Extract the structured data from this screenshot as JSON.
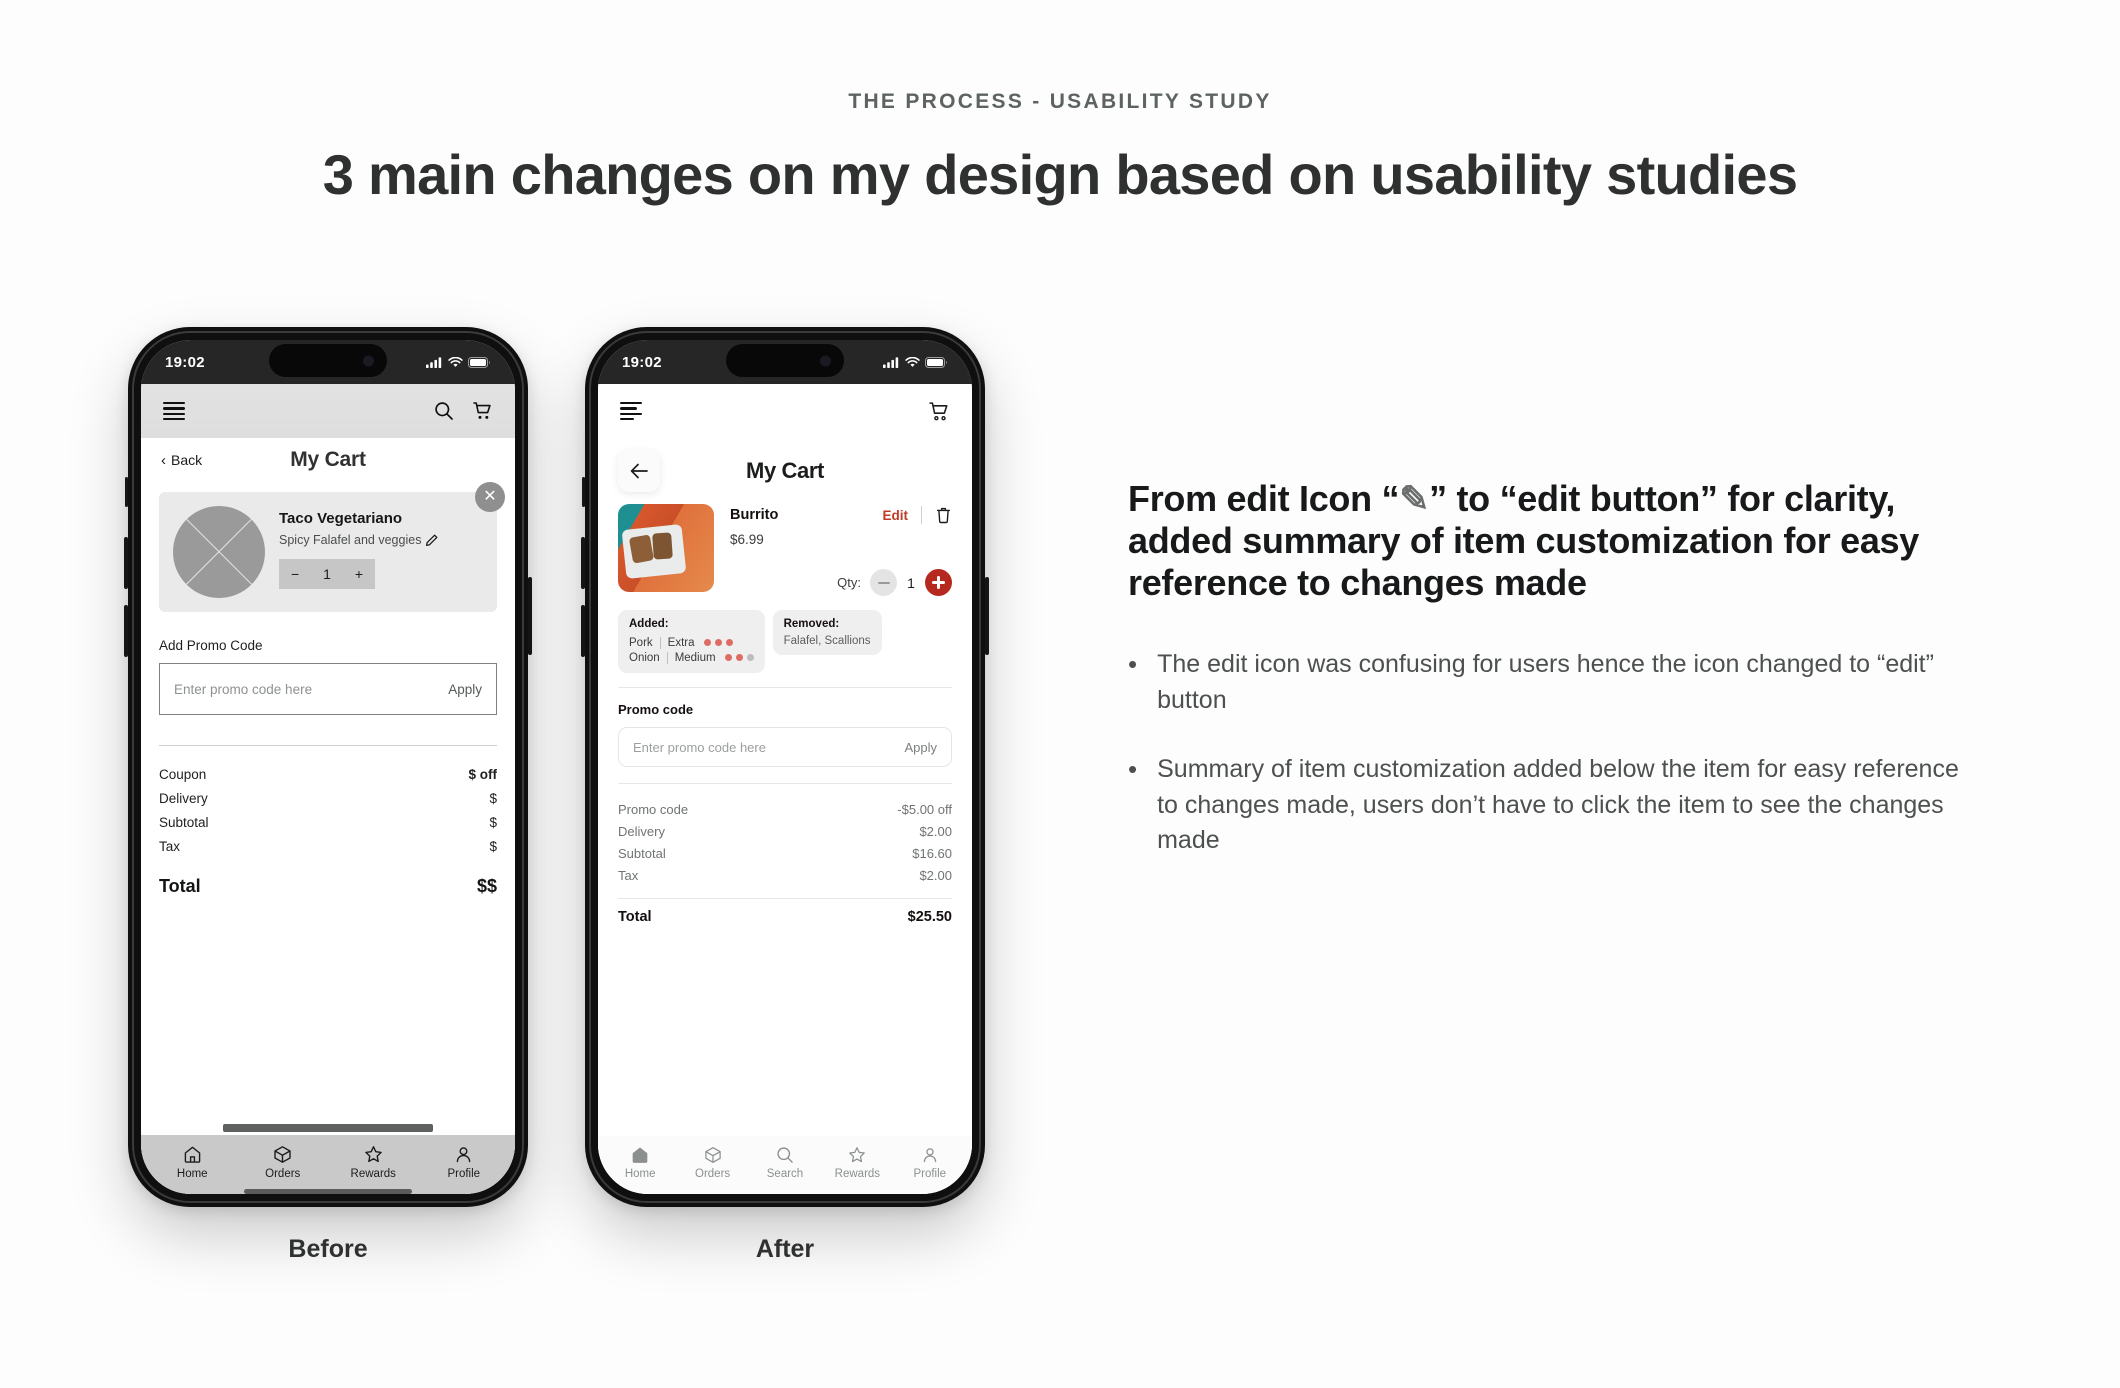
{
  "header": {
    "eyebrow": "THE PROCESS - USABILITY STUDY",
    "title": "3 main changes on my design based on usability studies"
  },
  "colors": {
    "accent_red": "#b5291f",
    "edit_red": "#bf3b25",
    "spice_dot": "#dd6d62",
    "spice_dot_empty": "#bdbdbd",
    "page_bg": "#fdfdfd",
    "text_dark": "#2e312f",
    "text_muted": "#6f7472"
  },
  "before": {
    "caption": "Before",
    "status": {
      "time": "19:02",
      "signal_icon": "cellular-bars-icon",
      "wifi_icon": "wifi-icon",
      "battery_icon": "battery-icon"
    },
    "appbar": {
      "menu_icon": "hamburger-menu-icon",
      "search_icon": "search-icon",
      "cart_icon": "cart-icon"
    },
    "back_label": "Back",
    "page_title": "My Cart",
    "item": {
      "name": "Taco Vegetariano",
      "description": "Spicy Falafel and veggies",
      "edit_icon": "pencil-edit-icon",
      "remove_icon": "close-x-icon",
      "qty_minus": "−",
      "qty_value": "1",
      "qty_plus": "+"
    },
    "promo": {
      "label": "Add Promo Code",
      "placeholder": "Enter promo code here",
      "apply_label": "Apply"
    },
    "summary_rows": [
      {
        "label": "Coupon",
        "value": "$ off"
      },
      {
        "label": "Delivery",
        "value": "$"
      },
      {
        "label": "Subtotal",
        "value": "$"
      },
      {
        "label": "Tax",
        "value": "$"
      }
    ],
    "total": {
      "label": "Total",
      "value": "$$"
    },
    "tabs": [
      {
        "label": "Home",
        "icon": "home-icon"
      },
      {
        "label": "Orders",
        "icon": "box-icon"
      },
      {
        "label": "Rewards",
        "icon": "star-icon"
      },
      {
        "label": "Profile",
        "icon": "person-icon"
      }
    ]
  },
  "after": {
    "caption": "After",
    "status": {
      "time": "19:02",
      "signal_icon": "cellular-bars-icon",
      "wifi_icon": "wifi-icon",
      "battery_icon": "battery-icon"
    },
    "appbar": {
      "menu_icon": "hamburger-menu-icon",
      "cart_icon": "cart-icon"
    },
    "back_icon": "arrow-left-icon",
    "page_title": "My Cart",
    "item": {
      "name": "Burrito",
      "price": "$6.99",
      "edit_label": "Edit",
      "delete_icon": "trash-icon",
      "qty_label": "Qty:",
      "qty_minus": "−",
      "qty_value": "1",
      "qty_plus": "+",
      "thumb_icon": "burrito-photo"
    },
    "added": {
      "heading": "Added:",
      "lines": [
        {
          "name": "Pork",
          "option": "Extra",
          "dots_filled": 3,
          "dots_total": 3
        },
        {
          "name": "Onion",
          "option": "Medium",
          "dots_filled": 2,
          "dots_total": 3
        }
      ]
    },
    "removed": {
      "heading": "Removed:",
      "body": "Falafel, Scallions"
    },
    "promo": {
      "label": "Promo code",
      "placeholder": "Enter promo code here",
      "apply_label": "Apply"
    },
    "summary_rows": [
      {
        "label": "Promo code",
        "value": "-$5.00 off"
      },
      {
        "label": "Delivery",
        "value": "$2.00"
      },
      {
        "label": "Subtotal",
        "value": "$16.60"
      },
      {
        "label": "Tax",
        "value": "$2.00"
      }
    ],
    "total": {
      "label": "Total",
      "value": "$25.50"
    },
    "tabs": [
      {
        "label": "Home",
        "icon": "home-icon"
      },
      {
        "label": "Orders",
        "icon": "box-icon"
      },
      {
        "label": "Search",
        "icon": "search-icon"
      },
      {
        "label": "Rewards",
        "icon": "star-icon"
      },
      {
        "label": "Profile",
        "icon": "person-icon"
      }
    ]
  },
  "right": {
    "heading_part1": "From edit Icon “",
    "heading_pen": "✎",
    "heading_part2": "” to “edit button” for clarity, added summary of item customization for easy reference to changes made",
    "bullets": [
      "The edit icon was confusing for users hence the icon changed to “edit” button",
      "Summary of item customization added below the item for easy reference to changes made, users don’t have to click the item to see the changes made"
    ]
  }
}
